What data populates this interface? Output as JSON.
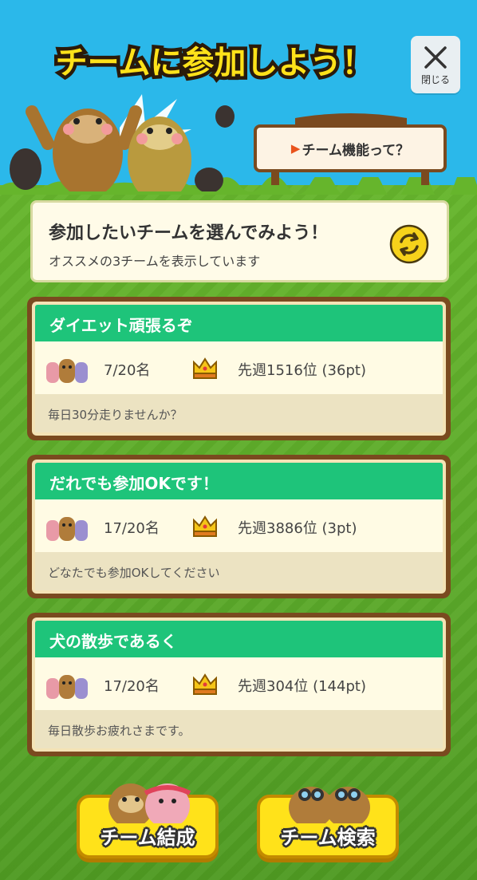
{
  "header": {
    "title": "チームに参加しよう！",
    "close_label": "閉じる",
    "sign_text": "チーム機能って？"
  },
  "intro": {
    "heading": "参加したいチームを選んでみよう！",
    "subtext": "オススメの3チームを表示しています"
  },
  "teams": [
    {
      "name": "ダイエット頑張るぞ",
      "members": "7/20名",
      "rank": "先週1516位 (36pt)",
      "description": "毎日30分走りませんか？"
    },
    {
      "name": "だれでも参加OKです！",
      "members": "17/20名",
      "rank": "先週3886位 (3pt)",
      "description": "どなたでも参加OKしてください"
    },
    {
      "name": "犬の散歩であるく",
      "members": "17/20名",
      "rank": "先週304位 (144pt)",
      "description": "毎日散歩お疲れさまです。"
    }
  ],
  "buttons": {
    "create": "チーム結成",
    "search": "チーム検索"
  },
  "icons": {
    "close": "close-icon",
    "refresh": "refresh-icon",
    "members": "members-icon",
    "crown": "crown-icon"
  },
  "colors": {
    "sky": "#2bb8ea",
    "grass": "#5fae2c",
    "card_header": "#1ec47a",
    "card_border": "#7a4a1f",
    "button_yellow": "#ffe21a"
  }
}
